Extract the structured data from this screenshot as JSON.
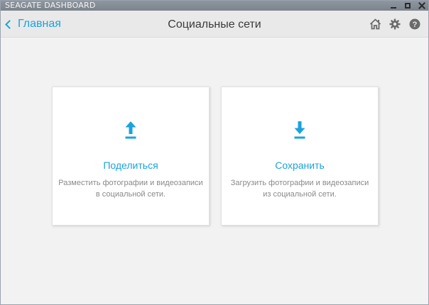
{
  "window": {
    "app_title": "SEAGATE DASHBOARD"
  },
  "header": {
    "back_label": "Главная",
    "title": "Социальные сети",
    "icons": [
      "home-icon",
      "gear-icon",
      "help-icon"
    ]
  },
  "cards": [
    {
      "icon": "upload-icon",
      "title": "Поделиться",
      "description": "Разместить фотографии и видеозаписи в социальной сети."
    },
    {
      "icon": "download-icon",
      "title": "Сохранить",
      "description": "Загрузить фотографии и видеозаписи из социальной сети."
    }
  ],
  "colors": {
    "accent": "#1aa3dd",
    "title_bar": "#858d96",
    "header_bg": "#e9e9ea",
    "page_bg": "#f2f2f2",
    "card_bg": "#ffffff",
    "desc_text": "#8a8a8a"
  }
}
